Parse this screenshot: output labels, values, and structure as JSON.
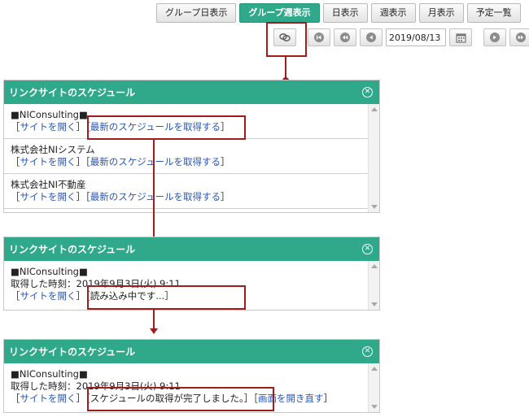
{
  "tabs": [
    {
      "label": "グループ日表示",
      "active": false
    },
    {
      "label": "グループ週表示",
      "active": true
    },
    {
      "label": "日表示",
      "active": false
    },
    {
      "label": "週表示",
      "active": false
    },
    {
      "label": "月表示",
      "active": false
    },
    {
      "label": "予定一覧",
      "active": false
    }
  ],
  "toolbar": {
    "date_value": "2019/08/13",
    "icons": [
      "link-icon",
      "skip-first-icon",
      "prev-fast-icon",
      "prev-icon",
      "calendar-icon",
      "next-icon",
      "next-fast-icon"
    ]
  },
  "panel1": {
    "title": "リンクサイトのスケジュール",
    "entries": [
      {
        "name": "■NIConsulting■",
        "open": "サイトを開く",
        "fetch": "最新のスケジュールを取得する"
      },
      {
        "name": "株式会社NIシステム",
        "open": "サイトを開く",
        "fetch": "最新のスケジュールを取得する"
      },
      {
        "name": "株式会社NI不動産",
        "open": "サイトを開く",
        "fetch": "最新のスケジュールを取得する"
      }
    ]
  },
  "panel2": {
    "title": "リンクサイトのスケジュール",
    "name": "■NIConsulting■",
    "fetched": "取得した時刻：2019年9月3日(火) 9:11",
    "open": "サイトを開く",
    "status": "読み込み中です..."
  },
  "panel3": {
    "title": "リンクサイトのスケジュール",
    "name": "■NIConsulting■",
    "fetched": "取得した時刻：2019年9月3日(火) 9:11",
    "open": "サイトを開く",
    "status": "スケジュールの取得が完了しました。",
    "reopen": "画面を開き直す"
  },
  "colors": {
    "accent": "#2fa98a",
    "callout": "#a11c1c",
    "link": "#2a56b8"
  }
}
